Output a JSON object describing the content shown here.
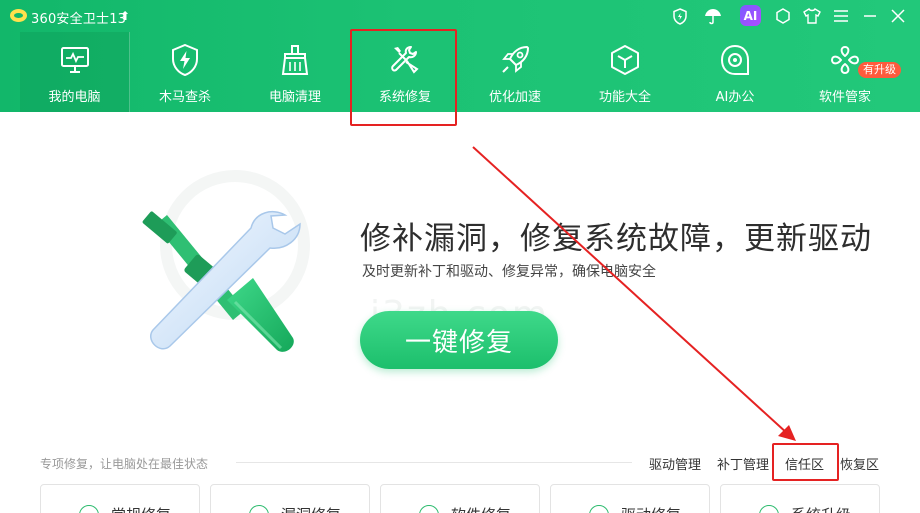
{
  "titlebar": {
    "app_title": "360安全卫士13",
    "upgrade_icon": "arrow-up-icon",
    "icons": [
      "shield-badge-icon",
      "umbrella-icon",
      "ai-icon",
      "skin-icon",
      "shirt-icon",
      "menu-icon",
      "minimize-icon",
      "close-icon"
    ],
    "ai_label": "AI"
  },
  "nav": {
    "items": [
      {
        "label": "我的电脑",
        "icon": "monitor-icon"
      },
      {
        "label": "木马查杀",
        "icon": "shield-bolt-icon"
      },
      {
        "label": "电脑清理",
        "icon": "broom-icon"
      },
      {
        "label": "系统修复",
        "icon": "wrench-screwdriver-icon"
      },
      {
        "label": "优化加速",
        "icon": "rocket-icon"
      },
      {
        "label": "功能大全",
        "icon": "cube-icon"
      },
      {
        "label": "AI办公",
        "icon": "ai-office-icon"
      },
      {
        "label": "软件管家",
        "icon": "flower-grid-icon"
      }
    ],
    "active": "我的电脑",
    "upgrade_badge": "有升级"
  },
  "hero": {
    "title": "修补漏洞，修复系统故障，更新驱动",
    "subtitle": "及时更新补丁和驱动、修复异常，确保电脑安全",
    "button_label": "一键修复",
    "watermark": "i3zh.com"
  },
  "bottom": {
    "section_label": "专项修复，让电脑处在最佳状态",
    "links": [
      "驱动管理",
      "补丁管理",
      "信任区",
      "恢复区"
    ],
    "cards": [
      "常规修复",
      "漏洞修复",
      "软件修复",
      "驱动修复",
      "系统升级"
    ]
  },
  "colors": {
    "header_green": "#1cc274",
    "button_green": "#1cbf6c",
    "annotation_red": "#e52222",
    "upgrade_badge": "#ff5b3d"
  }
}
